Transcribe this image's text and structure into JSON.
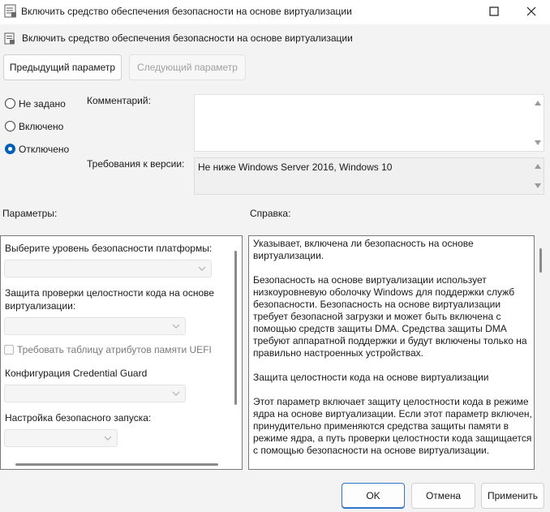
{
  "window": {
    "title": "Включить средство обеспечения безопасности на основе виртуализации"
  },
  "policy": {
    "title": "Включить средство обеспечения безопасности на основе виртуализации"
  },
  "nav": {
    "prev_label": "Предыдущий параметр",
    "next_label": "Следующий параметр"
  },
  "state": {
    "options": [
      {
        "label": "Не задано",
        "checked": false
      },
      {
        "label": "Включено",
        "checked": false
      },
      {
        "label": "Отключено",
        "checked": true
      }
    ]
  },
  "comment": {
    "label": "Комментарий:",
    "value": ""
  },
  "requirements": {
    "label": "Требования к версии:",
    "value": "Не ниже Windows Server 2016, Windows 10"
  },
  "options_panel": {
    "label": "Параметры:",
    "platform_label": "Выберите уровень безопасности платформы:",
    "hvci_label_line1": "Защита проверки целостности кода на основе",
    "hvci_label_line2": "виртуализации:",
    "uefi_checkbox_label": "Требовать таблицу атрибутов памяти UEFI",
    "credential_guard_label": "Конфигурация Credential Guard",
    "secure_launch_label": "Настройка безопасного запуска:"
  },
  "help_panel": {
    "label": "Справка:",
    "paragraphs": [
      "Указывает, включена ли безопасность на основе виртуализации.",
      "Безопасность на основе виртуализации использует низкоуровневую оболочку Windows для поддержки служб безопасности. Безопасность на основе виртуализации требует безопасной загрузки и может быть включена с помощью средств защиты DMA. Средства защиты DMA требуют аппаратной поддержки и будут включены только на правильно настроенных устройствах.",
      "Защита целостности кода на основе виртуализации",
      "Этот параметр включает защиту целостности кода в режиме ядра на основе виртуализации. Если этот параметр включен, принудительно применяются средства защиты памяти в режиме ядра, а путь проверки целостности кода защищается с помощью безопасности на основе виртуализации."
    ]
  },
  "footer": {
    "ok_label": "OK",
    "cancel_label": "Отмена",
    "apply_label": "Применить"
  }
}
